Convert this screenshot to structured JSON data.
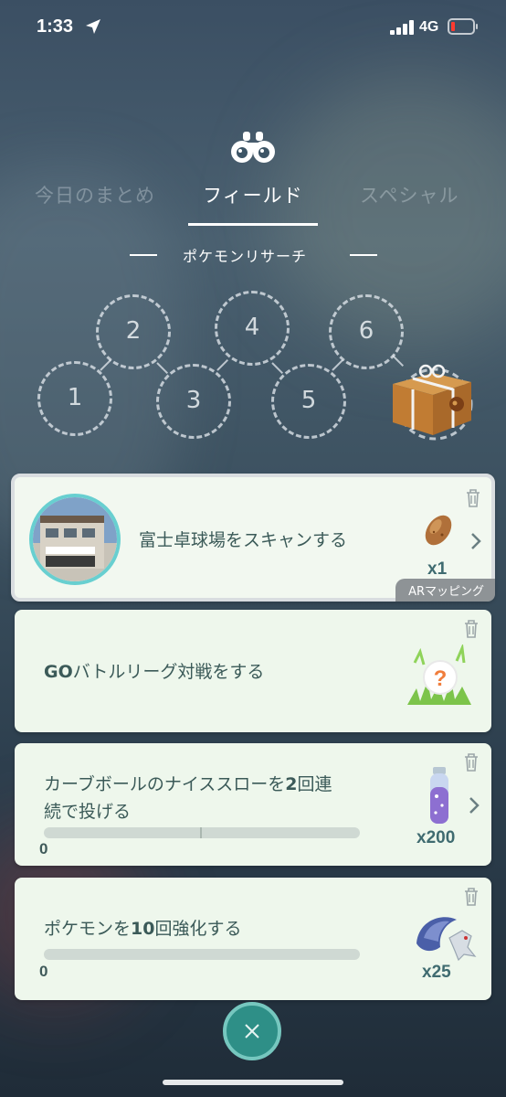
{
  "status_bar": {
    "time": "1:33",
    "network": "4G"
  },
  "header": {
    "tabs": [
      {
        "label": "今日のまとめ",
        "active": false
      },
      {
        "label": "フィールド",
        "active": true
      },
      {
        "label": "スペシャル",
        "active": false
      }
    ],
    "subheading": "ポケモンリサーチ"
  },
  "stamps": [
    "1",
    "2",
    "3",
    "4",
    "5",
    "6"
  ],
  "tasks": [
    {
      "text": "富士卓球場をスキャンする",
      "reward_icon": "potato-icon",
      "reward_count": "x1",
      "tag": "ARマッピング",
      "has_chevron": true,
      "selected": true
    },
    {
      "text_bold": "GO",
      "text": "バトルリーグ対戦をする",
      "reward_icon": "mystery-encounter-icon",
      "reward_count": "",
      "has_chevron": false
    },
    {
      "text_line1_a": "カーブボールのナイススローを",
      "text_line1_bold": "2",
      "text_line1_b": "回連",
      "text_line2": "続で投げる",
      "reward_icon": "stardust-icon",
      "reward_count": "x200",
      "progress": 0,
      "progress_label": "0",
      "has_chevron": true
    },
    {
      "text_a": "ポケモンを",
      "text_bold": "10",
      "text_b": "回強化する",
      "reward_icon": "mega-energy-icon",
      "reward_count": "x25",
      "progress": 0,
      "progress_label": "0",
      "has_chevron": false
    }
  ],
  "colors": {
    "accent": "#68cfd0",
    "close_button": "#2e8f87",
    "card_bg": "#eef7ec"
  }
}
